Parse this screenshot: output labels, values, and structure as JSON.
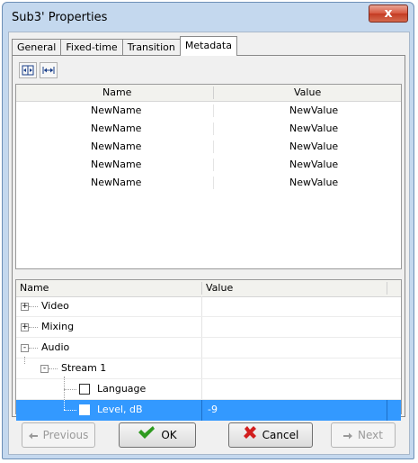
{
  "window": {
    "title": "Sub3' Properties",
    "close_label": "x"
  },
  "tabs": [
    {
      "label": "General"
    },
    {
      "label": "Fixed-time"
    },
    {
      "label": "Transition"
    },
    {
      "label": "Metadata",
      "active": true
    }
  ],
  "toolbar": {
    "buttons": [
      {
        "icon": "expand-columns-icon"
      },
      {
        "icon": "fit-columns-icon"
      }
    ]
  },
  "metadata_grid": {
    "columns": [
      "Name",
      "Value"
    ],
    "rows": [
      {
        "name": "NewName",
        "value": "NewValue"
      },
      {
        "name": "NewName",
        "value": "NewValue"
      },
      {
        "name": "NewName",
        "value": "NewValue"
      },
      {
        "name": "NewName",
        "value": "NewValue"
      },
      {
        "name": "NewName",
        "value": "NewValue"
      }
    ]
  },
  "properties_tree": {
    "columns": [
      "Name",
      "Value"
    ],
    "rows": [
      {
        "label": "Video",
        "expander": "+",
        "value": ""
      },
      {
        "label": "Mixing",
        "expander": "+",
        "value": ""
      },
      {
        "label": "Audio",
        "expander": "-",
        "value": ""
      },
      {
        "label": "Stream 1",
        "expander": "-",
        "value": ""
      },
      {
        "label": "Language",
        "checkbox": true,
        "value": ""
      },
      {
        "label": "Level, dB",
        "checkbox": true,
        "value": "-9",
        "selected": true
      }
    ]
  },
  "buttons": {
    "previous": "Previous",
    "ok": "OK",
    "cancel": "Cancel",
    "next": "Next"
  },
  "colors": {
    "selection": "#3399ff",
    "frame": "#c4d8ee",
    "ok_check": "#2e9a1f",
    "cancel_x": "#d21f1f"
  }
}
